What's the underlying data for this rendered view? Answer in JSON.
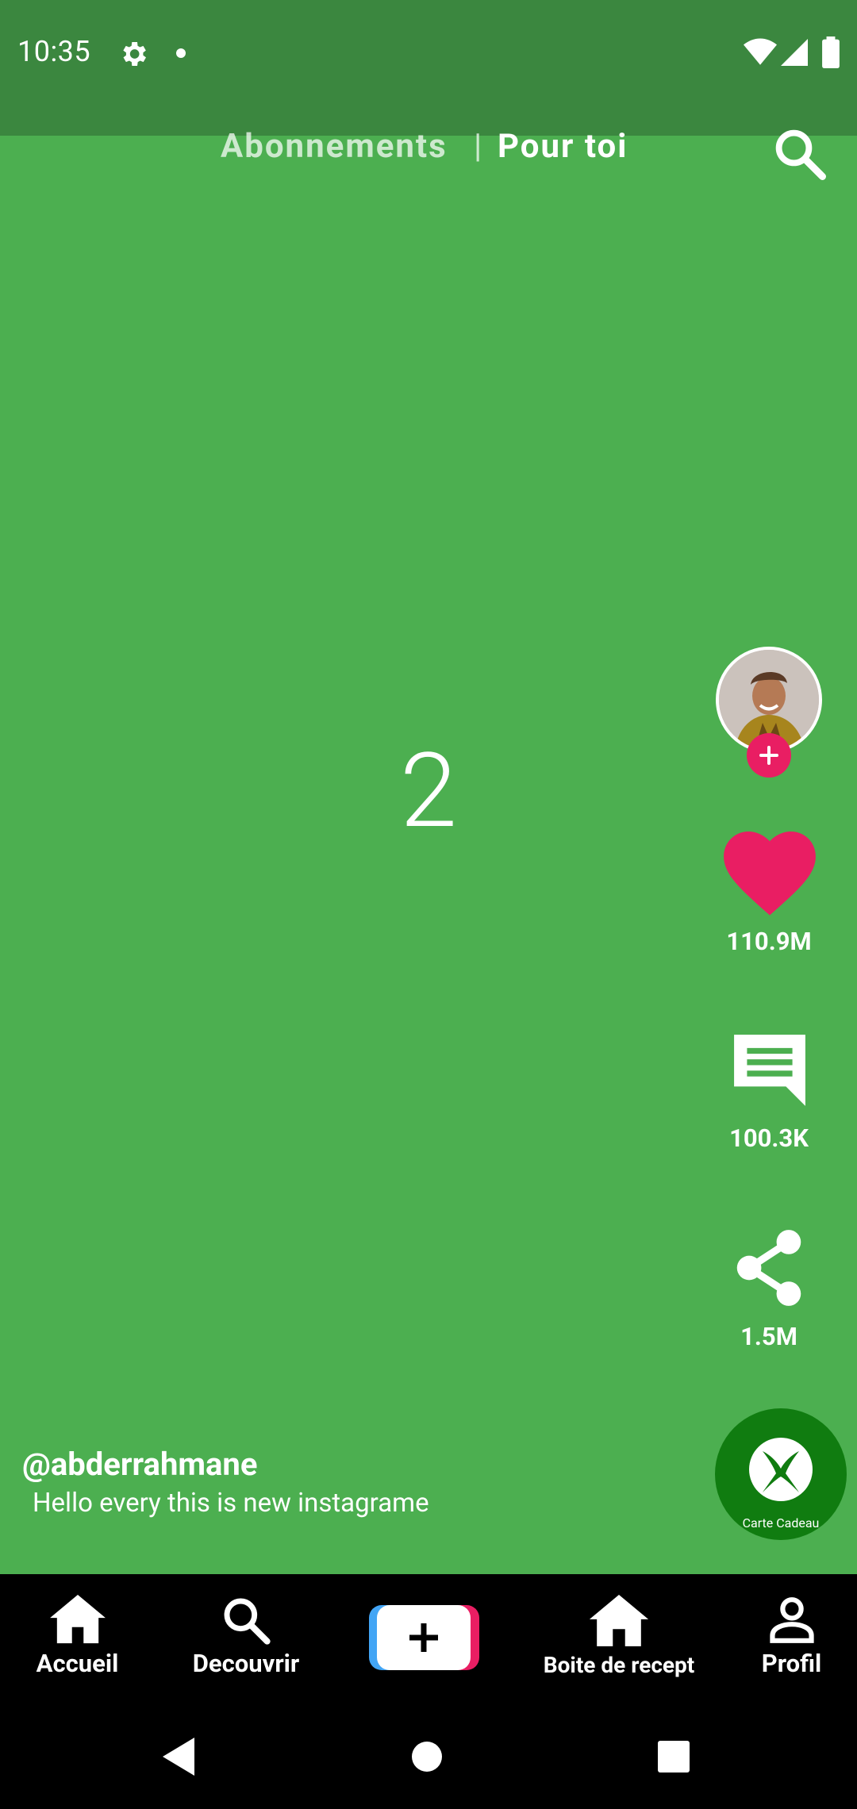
{
  "status_bar": {
    "time": "10:35"
  },
  "header": {
    "tab_following": "Abonnements",
    "separator": "|",
    "tab_for_you": "Pour toi"
  },
  "video": {
    "number": "2",
    "username": "@abderrahmane",
    "caption": "Hello every this is new instagrame"
  },
  "actions": {
    "likes": "110.9M",
    "comments": "100.3K",
    "shares": "1.5M"
  },
  "badge": {
    "label": "Carte Cadeau"
  },
  "bottom_nav": {
    "home": "Accueil",
    "discover": "Decouvrir",
    "inbox": "Boite de recept",
    "profile": "Profil"
  },
  "colors": {
    "background": "#4caf50",
    "status_bar": "#3b873f",
    "accent": "#e91e63",
    "xbox_green": "#107c10"
  },
  "icons": [
    "settings-icon",
    "dot-icon",
    "wifi-icon",
    "signal-icon",
    "battery-icon",
    "search-icon",
    "plus-icon",
    "heart-icon",
    "comment-icon",
    "share-icon",
    "xbox-icon",
    "home-icon",
    "search-icon",
    "inbox-icon",
    "profile-icon",
    "back-icon",
    "home-circle-icon",
    "recents-icon"
  ]
}
